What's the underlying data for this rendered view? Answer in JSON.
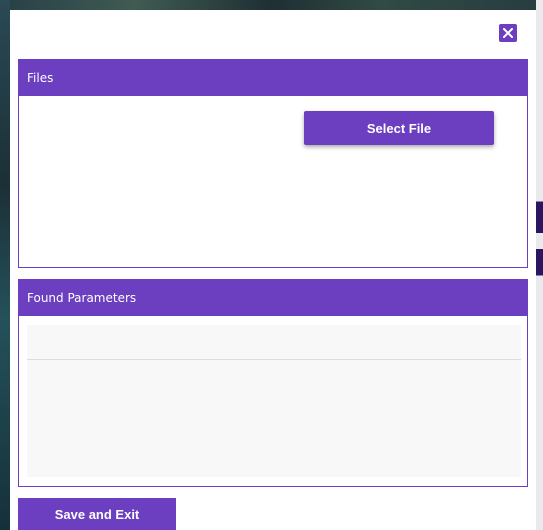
{
  "dialog": {
    "close_icon": "close-icon",
    "files_panel": {
      "title": "Files",
      "select_button_label": "Select File"
    },
    "params_panel": {
      "title": "Found Parameters",
      "rows": []
    },
    "save_button_label": "Save and Exit"
  },
  "colors": {
    "accent": "#6b3fbf",
    "list_background": "#f8f8f8"
  }
}
